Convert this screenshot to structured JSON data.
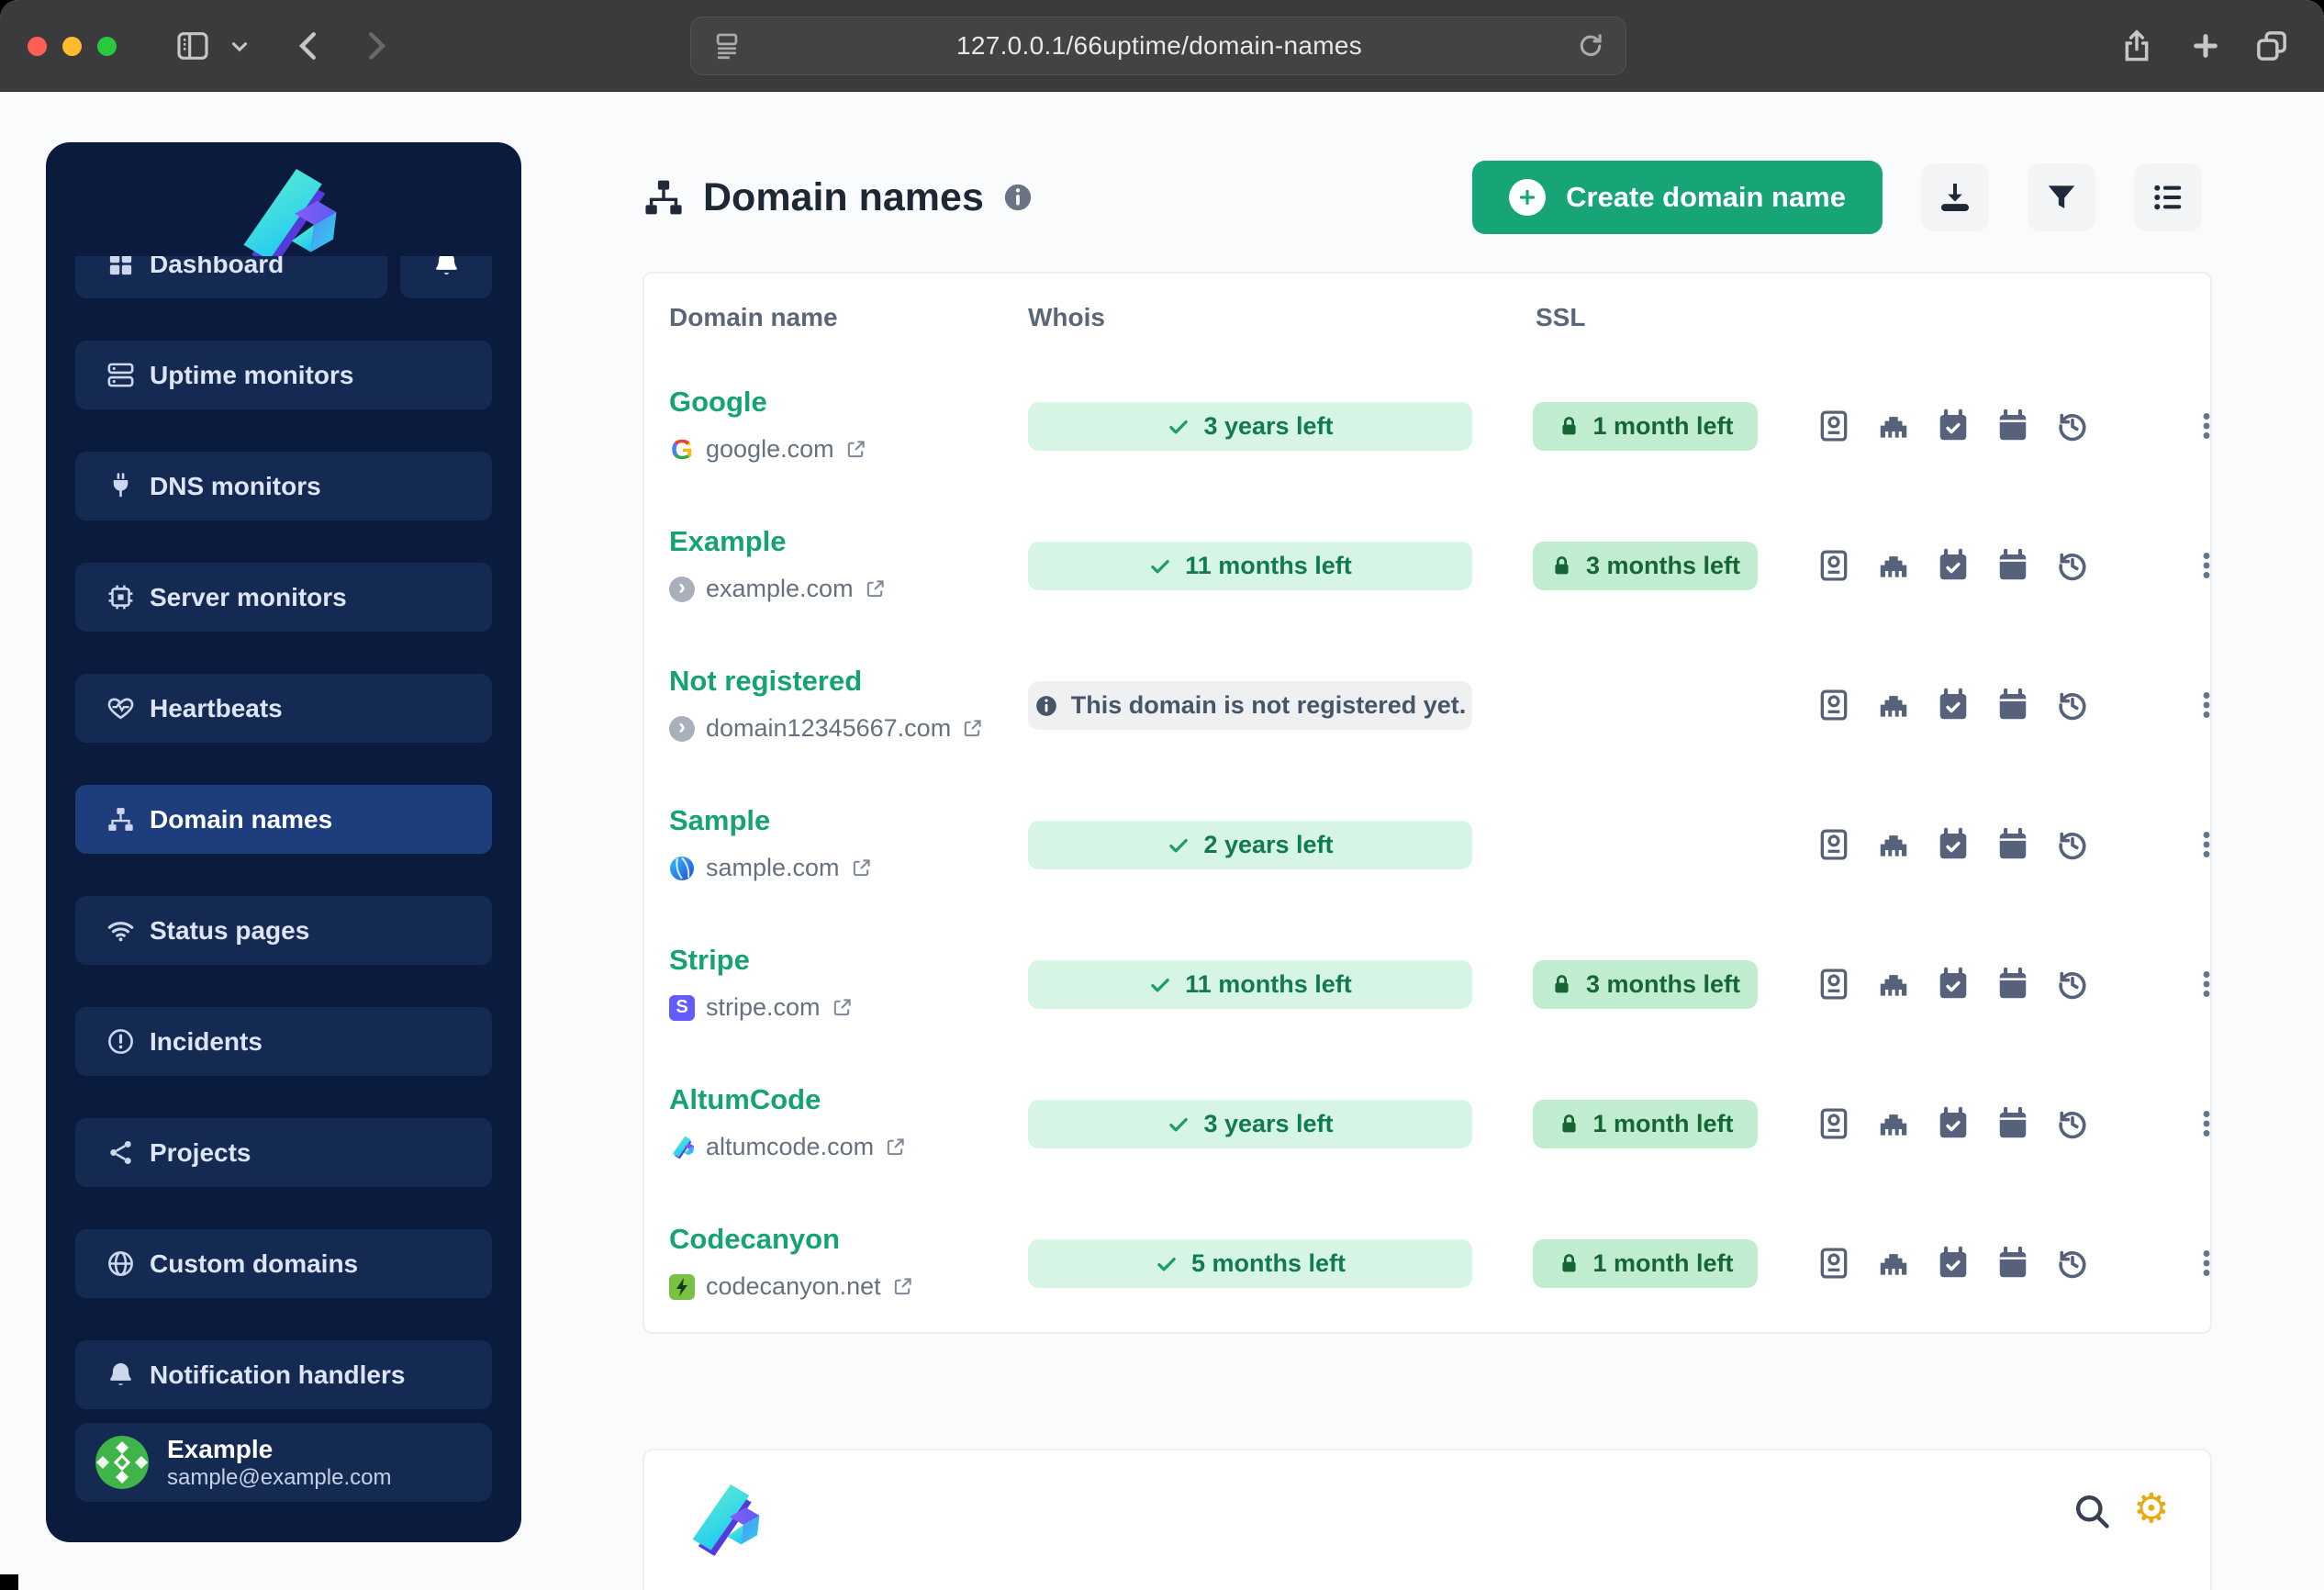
{
  "browser": {
    "url": "127.0.0.1/66uptime/domain-names",
    "icons": [
      "traffic-lights",
      "sidebar-toggle",
      "chevron-down",
      "back",
      "forward",
      "reader",
      "reload",
      "share",
      "new-tab",
      "tabs-overview"
    ]
  },
  "sidebar": {
    "items": [
      {
        "label": "Dashboard",
        "icon": "grid",
        "active": false
      },
      {
        "label": "Uptime monitors",
        "icon": "server",
        "active": false
      },
      {
        "label": "DNS monitors",
        "icon": "plug",
        "active": false
      },
      {
        "label": "Server monitors",
        "icon": "cpu",
        "active": false
      },
      {
        "label": "Heartbeats",
        "icon": "heart-pulse",
        "active": false
      },
      {
        "label": "Domain names",
        "icon": "sitemap",
        "active": true
      },
      {
        "label": "Status pages",
        "icon": "wifi",
        "active": false
      },
      {
        "label": "Incidents",
        "icon": "alert-circle",
        "active": false
      },
      {
        "label": "Projects",
        "icon": "share-nodes",
        "active": false
      },
      {
        "label": "Custom domains",
        "icon": "globe",
        "active": false
      },
      {
        "label": "Notification handlers",
        "icon": "bell",
        "active": false
      }
    ],
    "profile": {
      "name": "Example",
      "email": "sample@example.com"
    }
  },
  "header": {
    "title": "Domain names",
    "create_button": "Create domain name",
    "toolbar_icons": [
      "download",
      "filter",
      "list"
    ]
  },
  "table": {
    "columns": [
      "Domain name",
      "Whois",
      "SSL"
    ],
    "row_action_icons": [
      "whois-passport",
      "ethernet",
      "calendar-check",
      "calendar",
      "history"
    ],
    "rows": [
      {
        "name": "Google",
        "host": "google.com",
        "favicon": "google",
        "whois": {
          "type": "ok",
          "text": "3 years left"
        },
        "ssl": "1 month left"
      },
      {
        "name": "Example",
        "host": "example.com",
        "favicon": "generic",
        "whois": {
          "type": "ok",
          "text": "11 months left"
        },
        "ssl": "3 months left"
      },
      {
        "name": "Not registered",
        "host": "domain12345667.com",
        "favicon": "generic",
        "whois": {
          "type": "info",
          "text": "This domain is not registered yet."
        },
        "ssl": null
      },
      {
        "name": "Sample",
        "host": "sample.com",
        "favicon": "sphere",
        "whois": {
          "type": "ok",
          "text": "2 years left"
        },
        "ssl": null
      },
      {
        "name": "Stripe",
        "host": "stripe.com",
        "favicon": "stripe",
        "whois": {
          "type": "ok",
          "text": "11 months left"
        },
        "ssl": "3 months left"
      },
      {
        "name": "AltumCode",
        "host": "altumcode.com",
        "favicon": "altumcode",
        "whois": {
          "type": "ok",
          "text": "3 years left"
        },
        "ssl": "1 month left"
      },
      {
        "name": "Codecanyon",
        "host": "codecanyon.net",
        "favicon": "codecanyon",
        "whois": {
          "type": "ok",
          "text": "5 months left"
        },
        "ssl": "1 month left"
      }
    ]
  },
  "footer": {
    "icons": [
      "search",
      "gear"
    ]
  },
  "colors": {
    "accent_green": "#17a477",
    "sidebar_bg": "#0a1b3d",
    "sidebar_item_bg": "#152a52",
    "sidebar_active_bg": "#1e3d7c",
    "whois_badge_bg": "#d6f5e5",
    "whois_badge_text": "#117a50",
    "ssl_badge_bg": "#c0edcf",
    "ssl_badge_text": "#166534",
    "info_badge_bg": "#eef0f2",
    "info_badge_text": "#475569",
    "stripe_favicon": "#635bff",
    "codecanyon_favicon": "#7ac143",
    "gear_icon": "#e9a912"
  }
}
